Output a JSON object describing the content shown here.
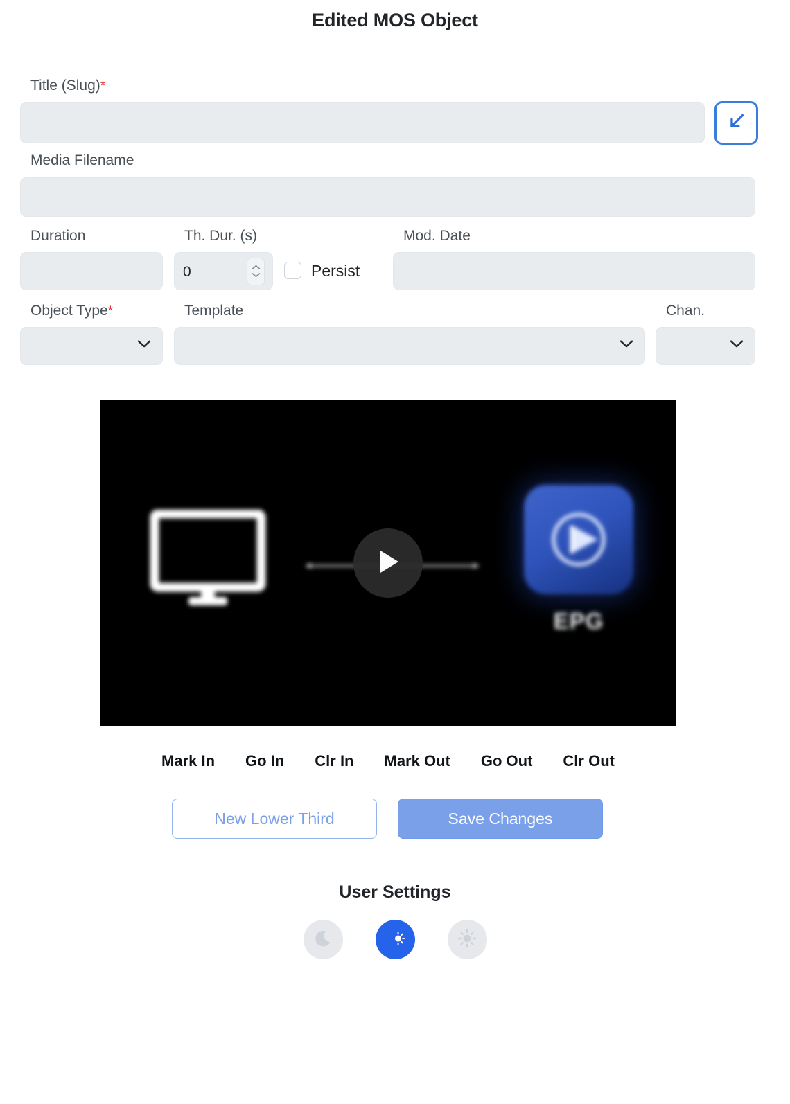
{
  "header": {
    "title": "Edited MOS Object"
  },
  "form": {
    "title_slug": {
      "label": "Title (Slug)",
      "required_marker": "*",
      "value": "",
      "placeholder": ""
    },
    "insert_button": {
      "icon": "arrow-down-left-icon",
      "accent_color": "#3b7ddd"
    },
    "media_filename": {
      "label": "Media Filename",
      "value": "",
      "placeholder": ""
    },
    "duration": {
      "label": "Duration",
      "value": "",
      "placeholder": ""
    },
    "thumb_duration": {
      "label": "Th. Dur. (s)",
      "value": "0",
      "placeholder": ""
    },
    "persist": {
      "label": "Persist",
      "checked": false
    },
    "mod_date": {
      "label": "Mod. Date",
      "value": "",
      "placeholder": ""
    },
    "object_type": {
      "label": "Object Type",
      "required_marker": "*",
      "selected": "",
      "options": []
    },
    "template": {
      "label": "Template",
      "selected": "",
      "options": []
    },
    "channel": {
      "label": "Chan.",
      "selected": "",
      "options": []
    }
  },
  "preview": {
    "background_color": "#000000",
    "play_button_icon": "play-icon",
    "thumbnail": {
      "monitor_icon": "monitor-icon",
      "arrow_icon": "double-arrow-icon",
      "app_tile_icon": "play-circle-icon",
      "app_tile_caption": "EPG",
      "app_tile_color": "#2f55bd"
    }
  },
  "mark_controls": [
    {
      "label": "Mark In"
    },
    {
      "label": "Go In"
    },
    {
      "label": "Clr In"
    },
    {
      "label": "Mark Out"
    },
    {
      "label": "Go Out"
    },
    {
      "label": "Clr Out"
    }
  ],
  "actions": {
    "new_lower_third": "New Lower Third",
    "save_changes": "Save Changes",
    "primary_color": "#7ba0ea"
  },
  "user_settings": {
    "title": "User Settings",
    "themes": [
      {
        "name": "dark",
        "icon": "moon-icon",
        "active": false
      },
      {
        "name": "auto",
        "icon": "moon-sun-icon",
        "active": true
      },
      {
        "name": "light",
        "icon": "sun-icon",
        "active": false
      }
    ],
    "active_color": "#2563eb",
    "inactive_color": "#e6e8ec"
  }
}
